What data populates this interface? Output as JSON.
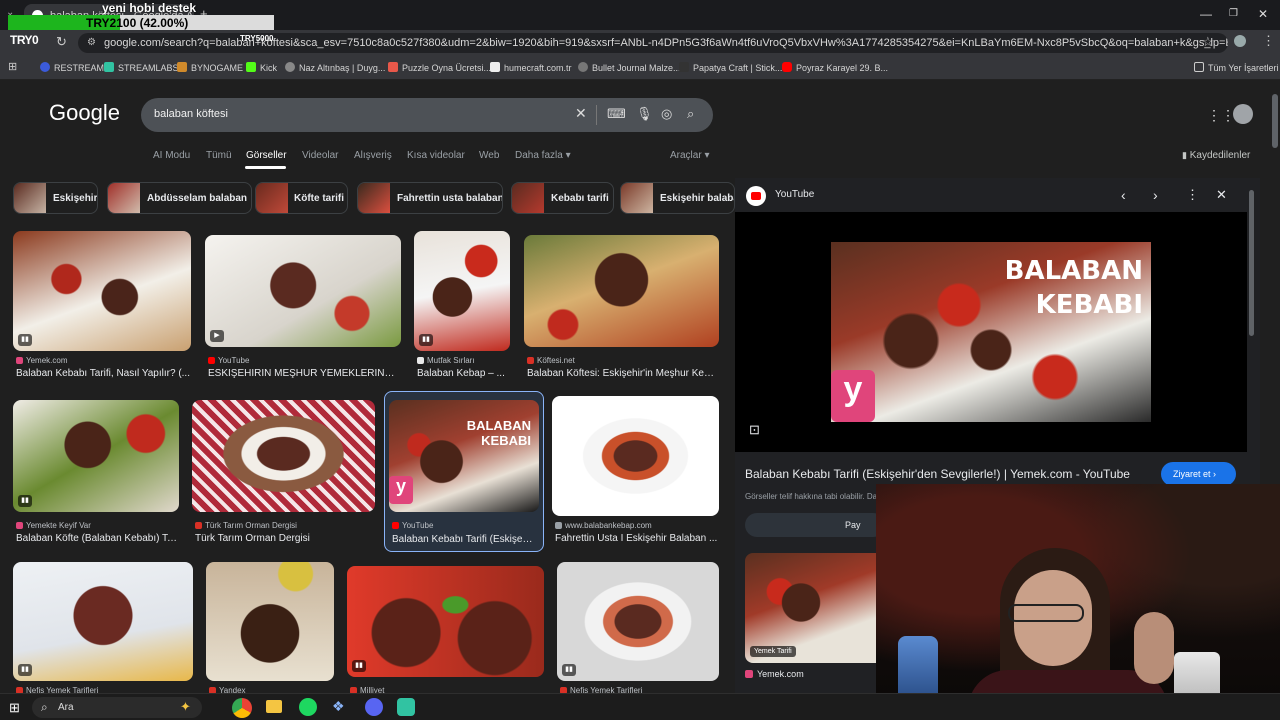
{
  "overlay": {
    "title": "yeni hobi destek",
    "progress_text": "TRY2100 (42.00%)",
    "progress_fraction": 0.42,
    "brand": "TRY0",
    "goal": "TRY5000"
  },
  "browser": {
    "tab_title": "balaban köftesi - Google'da Ara",
    "url": "google.com/search?q=balaban+köftesi&sca_esv=7510c8a0c527f380&udm=2&biw=1920&bih=919&sxsrf=ANbL-n4DPn5G3f6aWn4tf6uVroQ5VbxVHw%3A1774285354275&ei=KnLBaYm6EM-Nxc8P5vSbcQ&oq=balaban+k&gs_lp=Egtnd3Mtd2l6LWltZylJYmFsYWJ...",
    "bookmarks": [
      "RESTREAM",
      "STREAMLABS",
      "BYNOGAME",
      "Kick",
      "Naz Altınbaş | Duyg...",
      "Puzzle Oyna Ücretsi...",
      "humecraft.com.tr",
      "Bullet Journal Malze...",
      "Papatya Craft | Stick...",
      "Poyraz Karayel 29. B..."
    ],
    "all_bookmarks": "Tüm Yer İşaretleri",
    "accent": "#8ab4f8"
  },
  "google": {
    "logo": "Google",
    "query": "balaban köftesi",
    "tabs": [
      "AI Modu",
      "Tümü",
      "Görseller",
      "Videolar",
      "Alışveriş",
      "Kısa videolar",
      "Web",
      "Daha fazla"
    ],
    "active_tab": "Görseller",
    "tools": "Araçlar",
    "saved": "Kaydedilenler",
    "chips": [
      "Eskişehir",
      "Abdüsselam balaban",
      "Köfte tarifi",
      "Fahrettin usta balaban",
      "Kebabı tarifi",
      "Eskişehir balaban"
    ]
  },
  "results": [
    {
      "source": "Yemek.com",
      "title": "Balaban Kebabı Tarifi, Nasıl Yapılır? (...",
      "src_color": "#e0457b"
    },
    {
      "source": "YouTube",
      "title": "ESKİŞEHİRİN MEŞHUR YEMEKLERİND...",
      "src_color": "#ff0000"
    },
    {
      "source": "Mutfak Sırları",
      "title": "Balaban Kebap – ...",
      "src_color": "#e9e9e9"
    },
    {
      "source": "Köftesi.net",
      "title": "Balaban Köftesi: Eskişehir'in Meşhur Keb...",
      "src_color": "#d93025"
    },
    {
      "source": "Yemekte Keyif Var",
      "title": "Balaban Köfte (Balaban Kebabı) Ta...",
      "src_color": "#e0457b"
    },
    {
      "source": "Türk Tarım Orman Dergisi",
      "title": "Türk Tarım Orman Dergisi",
      "src_color": "#d93025"
    },
    {
      "source": "YouTube",
      "title": "Balaban Kebabı Tarifi (Eskişehi...",
      "src_color": "#ff0000"
    },
    {
      "source": "www.balabankebap.com",
      "title": "Fahrettin Usta I Eskişehir Balaban ...",
      "src_color": "#9aa0a6"
    },
    {
      "source": "Nefis Yemek Tarifleri",
      "title": "",
      "src_color": "#d93025"
    },
    {
      "source": "Yandex",
      "title": "",
      "src_color": "#d93025"
    },
    {
      "source": "Milliyet",
      "title": "",
      "src_color": "#d93025"
    },
    {
      "source": "Nefis Yemek Tarifleri",
      "title": "",
      "src_color": "#d93025"
    }
  ],
  "preview": {
    "site": "YouTube",
    "image_text_1": "BALABAN",
    "image_text_2": "KEBABI",
    "title": "Balaban Kebabı Tarifi (Eskişehir'den Sevgilerle!) | Yemek.com - YouTube",
    "visit": "Ziyaret et",
    "copyright": "Görseller telif hakkına tabi olabilir. Da",
    "share": "Pay",
    "related_badge": "Yemek Tarifi",
    "related_source": "Yemek.com"
  },
  "taskbar": {
    "search": "Ara"
  }
}
